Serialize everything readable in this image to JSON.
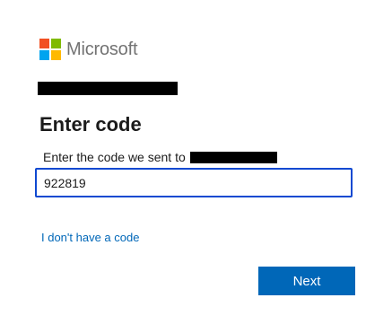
{
  "brand": {
    "name": "Microsoft",
    "logo_colors": [
      "#f25022",
      "#7fba00",
      "#00a4ef",
      "#ffb900"
    ]
  },
  "page": {
    "title": "Enter code",
    "instruction": "Enter the code we sent to"
  },
  "code_input": {
    "value": "922819"
  },
  "links": {
    "no_code": "I don't have a code"
  },
  "buttons": {
    "next": "Next"
  },
  "colors": {
    "accent": "#0067b8",
    "input_border": "#0f49d1",
    "logo_text": "#737373"
  }
}
